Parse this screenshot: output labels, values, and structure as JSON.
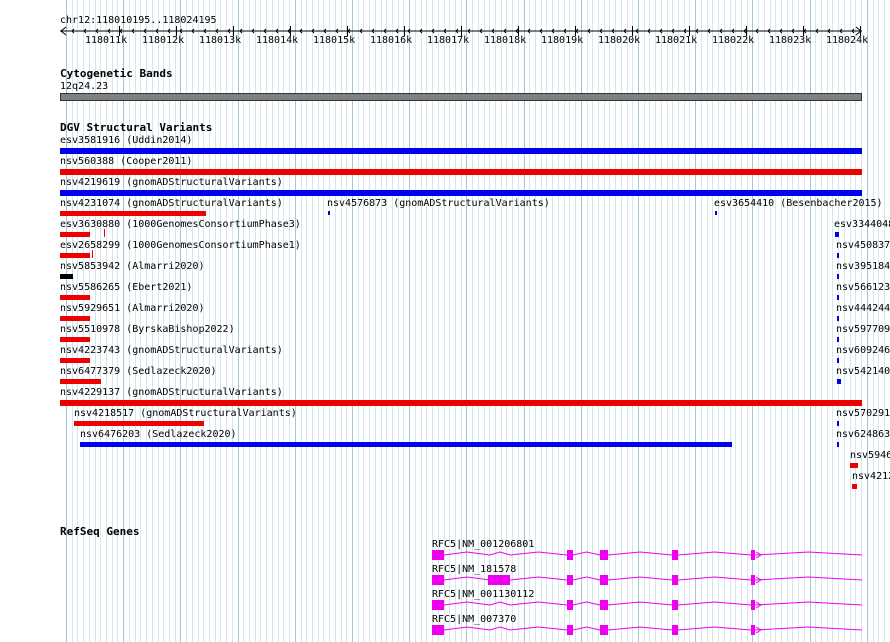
{
  "locus": "chr12:118010195..118024195",
  "ruler": {
    "ticks": [
      {
        "label": "118011k"
      },
      {
        "label": "118012k"
      },
      {
        "label": "118013k"
      },
      {
        "label": "118014k"
      },
      {
        "label": "118015k"
      },
      {
        "label": "118016k"
      },
      {
        "label": "118017k"
      },
      {
        "label": "118018k"
      },
      {
        "label": "118019k"
      },
      {
        "label": "118020k"
      },
      {
        "label": "118021k"
      },
      {
        "label": "118022k"
      },
      {
        "label": "118023k"
      },
      {
        "label": "118024k"
      }
    ]
  },
  "cytobands": {
    "title": "Cytogenetic Bands",
    "band": "12q24.23",
    "color": "#808080"
  },
  "dgv": {
    "title": "DGV Structural Variants",
    "colors": {
      "blue": "#0000ee",
      "red": "#ee0000",
      "black": "#000000"
    },
    "features": [
      {
        "label": "esv3581916 (Uddin2014)"
      },
      {
        "label": "nsv560388 (Cooper2011)"
      },
      {
        "label": "nsv4219619 (gnomADStructuralVariants)"
      },
      {
        "label": "nsv4231074 (gnomADStructuralVariants)"
      },
      {
        "label": "nsv4576873 (gnomADStructuralVariants)"
      },
      {
        "label": "esv3654410 (Besenbacher2015)"
      },
      {
        "label": "esv3630880 (1000GenomesConsortiumPhase3)"
      },
      {
        "label": "esv2658299 (1000GenomesConsortiumPhase1)"
      },
      {
        "label": "nsv5853942 (Almarri2020)"
      },
      {
        "label": "nsv5586265 (Ebert2021)"
      },
      {
        "label": "nsv5929651 (Almarri2020)"
      },
      {
        "label": "nsv5510978 (ByrskaBishop2022)"
      },
      {
        "label": "nsv4223743 (gnomADStructuralVariants)"
      },
      {
        "label": "nsv6477379 (Sedlazeck2020)"
      },
      {
        "label": "nsv4229137 (gnomADStructuralVariants)"
      },
      {
        "label": "nsv4218517 (gnomADStructuralVariants)"
      },
      {
        "label": "nsv6476203 (Sedlazeck2020)"
      },
      {
        "label": "esv3344048"
      },
      {
        "label": "nsv450837"
      },
      {
        "label": "nsv395184"
      },
      {
        "label": "nsv566123"
      },
      {
        "label": "nsv444244"
      },
      {
        "label": "nsv597709"
      },
      {
        "label": "nsv609246"
      },
      {
        "label": "nsv542140"
      },
      {
        "label": "nsv570291"
      },
      {
        "label": "nsv624863"
      },
      {
        "label": "nsv5946"
      },
      {
        "label": "nsv4212"
      }
    ]
  },
  "refseq": {
    "title": "RefSeq Genes",
    "color": "#ee00ee",
    "transcripts": [
      {
        "label": "RFC5|NM_001206801"
      },
      {
        "label": "RFC5|NM_181578"
      },
      {
        "label": "RFC5|NM_001130112"
      },
      {
        "label": "RFC5|NM_007370"
      }
    ]
  }
}
